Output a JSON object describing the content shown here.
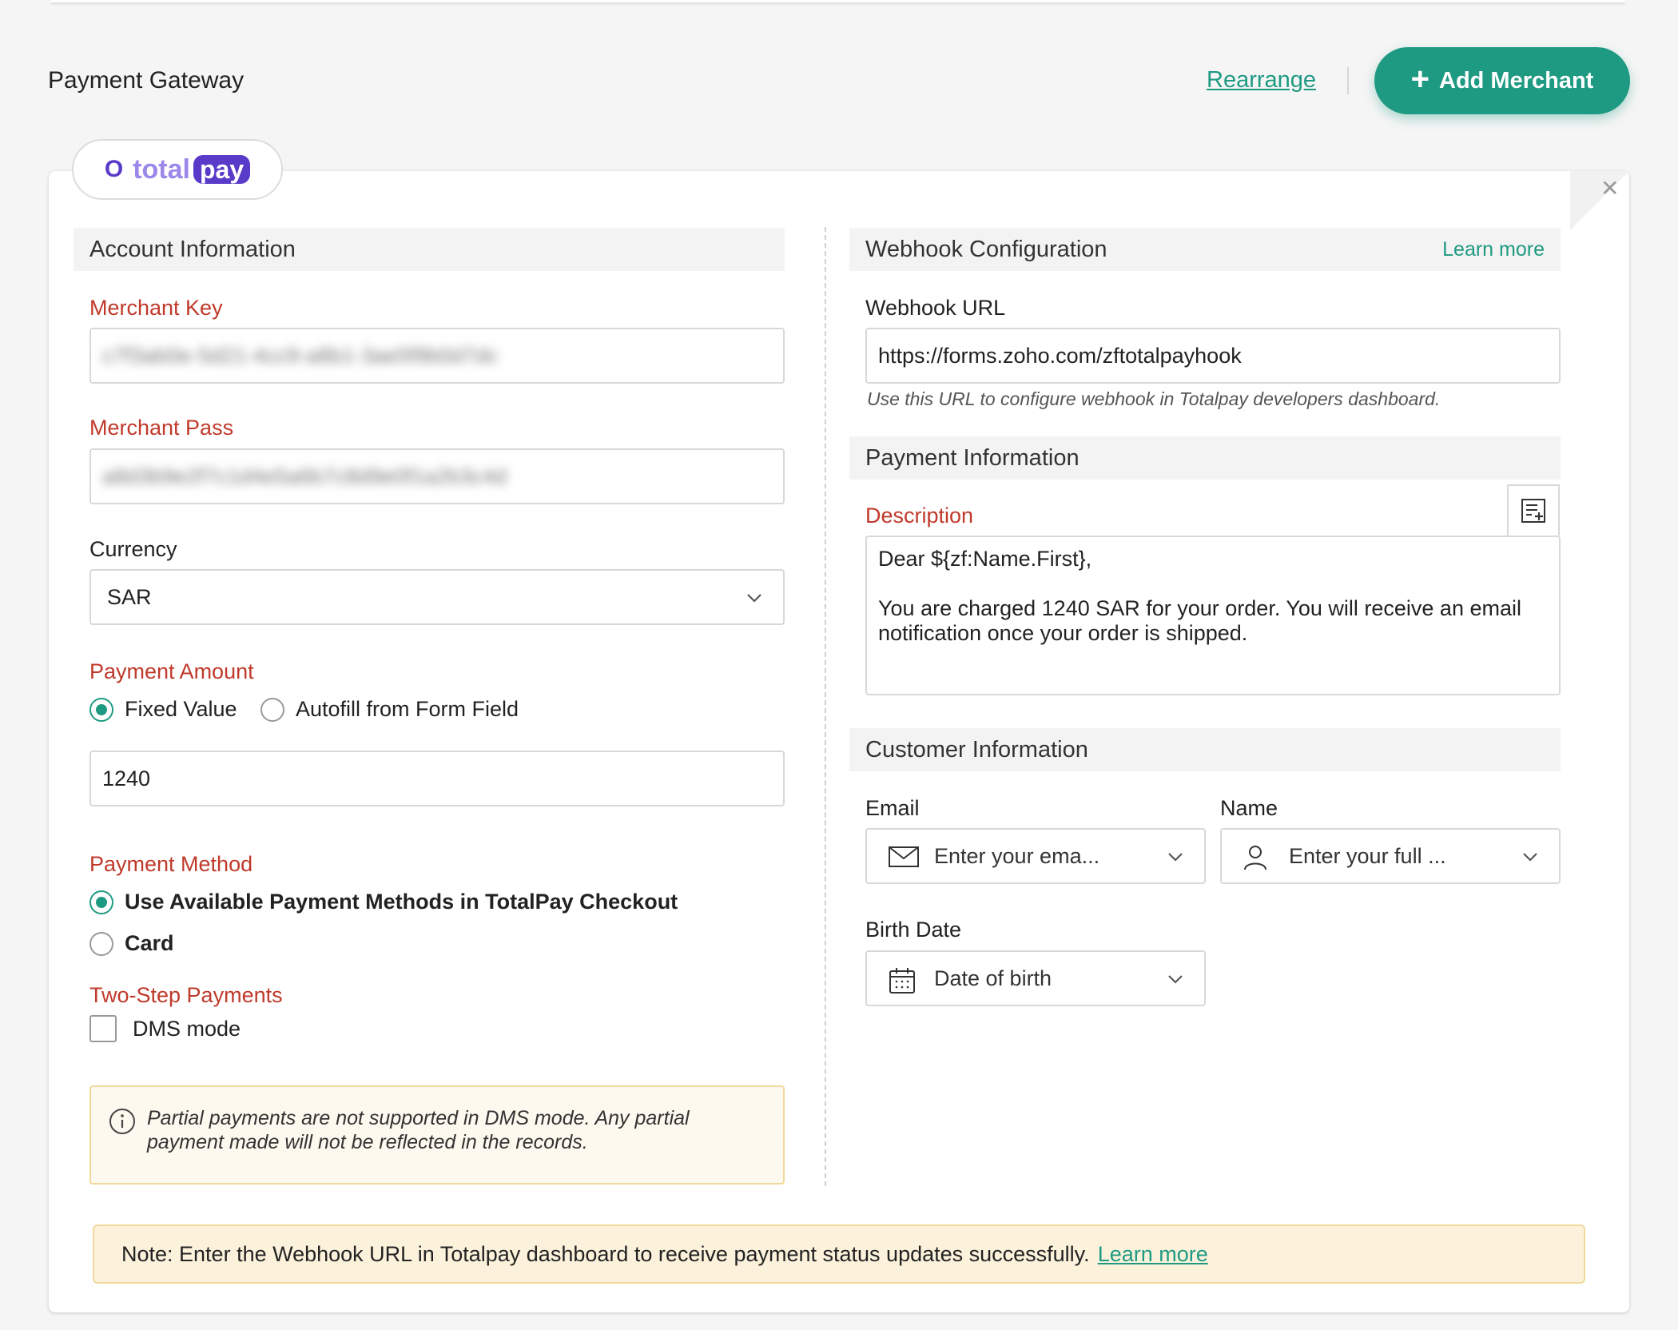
{
  "header": {
    "title": "Payment Gateway",
    "rearrange_label": "Rearrange",
    "add_merchant_label": "Add Merchant"
  },
  "gateway": {
    "logo_text_total": "total",
    "logo_text_pay": "pay"
  },
  "account": {
    "section_title": "Account Information",
    "merchant_key_label": "Merchant Key",
    "merchant_key_value": "c7f3ab0e-5d21-4cc9-a8b1-3ae5f9b0d7dc",
    "merchant_pass_label": "Merchant Pass",
    "merchant_pass_value": "a8d3b9e2f7c1d4e5a6b7c8d9e0f1a2b3c4d",
    "currency_label": "Currency",
    "currency_value": "SAR",
    "payment_amount_label": "Payment Amount",
    "amount_options": [
      "Fixed Value",
      "Autofill from Form Field"
    ],
    "amount_value": "1240",
    "payment_method_label": "Payment Method",
    "method_options": [
      "Use Available Payment Methods in TotalPay Checkout",
      "Card"
    ],
    "two_step_label": "Two-Step Payments",
    "dms_label": "DMS mode",
    "dms_warning": "Partial payments are not supported in DMS mode. Any partial payment made will not be reflected in the records."
  },
  "webhook": {
    "section_title": "Webhook Configuration",
    "learn_more": "Learn more",
    "url_label": "Webhook URL",
    "url_value": "https://forms.zoho.com/zftotalpayhook",
    "hint": "Use this URL to configure webhook in Totalpay developers dashboard."
  },
  "payment_info": {
    "section_title": "Payment Information",
    "description_label": "Description",
    "description_line1": "Dear  ${zf:Name.First},",
    "description_line2": "You are charged 1240 SAR for your order. You will receive an email notification once your order is shipped."
  },
  "customer": {
    "section_title": "Customer Information",
    "email_label": "Email",
    "email_placeholder": "Enter your ema...",
    "name_label": "Name",
    "name_placeholder": "Enter your full ...",
    "birth_label": "Birth Date",
    "birth_placeholder": "Date of birth"
  },
  "note": {
    "text": "Note: Enter the Webhook URL in Totalpay dashboard to receive payment status updates successfully.",
    "link": "Learn more"
  },
  "colors": {
    "accent": "#1f9a82",
    "required_label": "#c0392b",
    "brand_purple": "#5a3ac8"
  },
  "icons": [
    "plus-icon",
    "close-icon",
    "chevron-down-icon",
    "info-icon",
    "insert-field-icon",
    "mail-icon",
    "user-icon",
    "calendar-icon"
  ]
}
